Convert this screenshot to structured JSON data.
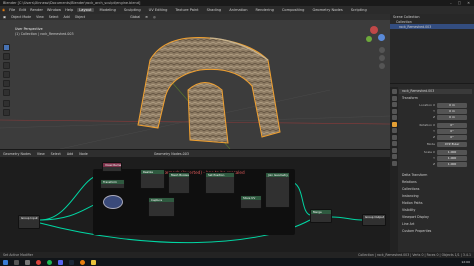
{
  "window": {
    "title": "Blender [C:\\Users\\Xinneaz\\Documents\\Blender\\rock_arch_sculpt\\engine.blend]"
  },
  "menubar": {
    "items": [
      "File",
      "Edit",
      "Render",
      "Window",
      "Help"
    ],
    "tabs": [
      "Layout",
      "Modeling",
      "Sculpting",
      "UV Editing",
      "Texture Paint",
      "Shading",
      "Animation",
      "Rendering",
      "Compositing",
      "Geometry Nodes",
      "Scripting"
    ],
    "active_tab": "Layout"
  },
  "viewport": {
    "mode": "Object Mode",
    "view_menus": [
      "View",
      "Select",
      "Add",
      "Object"
    ],
    "orientation": "Global",
    "overlay_title": "User Perspective",
    "overlay_collection": "(1) Collection | rock_Remeshed.003",
    "colors": {
      "background": "#3c3c3c",
      "rock": "#9d8a70",
      "selection": "#f0a030"
    }
  },
  "outliner": {
    "rows": [
      "Scene Collection",
      "Collection",
      "rock_Remeshed.003"
    ],
    "selected_index": 2
  },
  "properties": {
    "object_name": "rock_Remeshed.003",
    "sections": [
      "Transform"
    ],
    "transform_labels": {
      "location": "Location X",
      "y": "Y",
      "z": "Z",
      "rotation": "Rotation X",
      "mode": "Mode",
      "scale": "Scale X"
    },
    "location": [
      "0 m",
      "0 m",
      "0 m"
    ],
    "rotation": [
      "0°",
      "0°",
      "0°"
    ],
    "rotation_mode": "XYZ Euler",
    "scale": [
      "1.000",
      "1.000",
      "1.000"
    ],
    "panels": [
      "Delta Transform",
      "Relations",
      "Collections",
      "Instancing",
      "Motion Paths",
      "Visibility",
      "Viewport Display",
      "Line Art",
      "Custom Properties"
    ]
  },
  "node_editor": {
    "header_items": [
      "Geometry Nodes",
      "View",
      "Select",
      "Add",
      "Node"
    ],
    "modifier_name": "Geometry Nodes.003",
    "frame_title": "UVs with Remesh (Inverted) - has to be rescaled",
    "nodes": [
      {
        "title": "Group Input",
        "color": "#3a3a3a"
      },
      {
        "title": "Transform",
        "color": "#2f5a40"
      },
      {
        "title": "Voxel Remesh",
        "color": "#7a3048"
      },
      {
        "title": "Realize",
        "color": "#2f5a40"
      },
      {
        "title": "Mesh Boolean",
        "color": "#2f5a40"
      },
      {
        "title": "Set Position",
        "color": "#2f5a40"
      },
      {
        "title": "Capture",
        "color": "#2f5a40"
      },
      {
        "title": "Store UV",
        "color": "#2f5a40"
      },
      {
        "title": "Join Geometry",
        "color": "#2f5a40"
      },
      {
        "title": "Merge",
        "color": "#2f5a40"
      },
      {
        "title": "Group Output",
        "color": "#3a3a3a"
      }
    ]
  },
  "statusbar": {
    "left": "Set Active Modifier",
    "right": "Collection | rock_Remeshed.003 | Verts 0 | Faces 0 | Objects 1/1 | 3.4.1"
  },
  "taskbar": {
    "icons": [
      "windows-icon",
      "search-icon",
      "files-icon",
      "chrome-icon",
      "spotify-icon",
      "discord-icon",
      "steam-icon",
      "blender-icon",
      "folder-icon"
    ],
    "clock": "12:00"
  }
}
